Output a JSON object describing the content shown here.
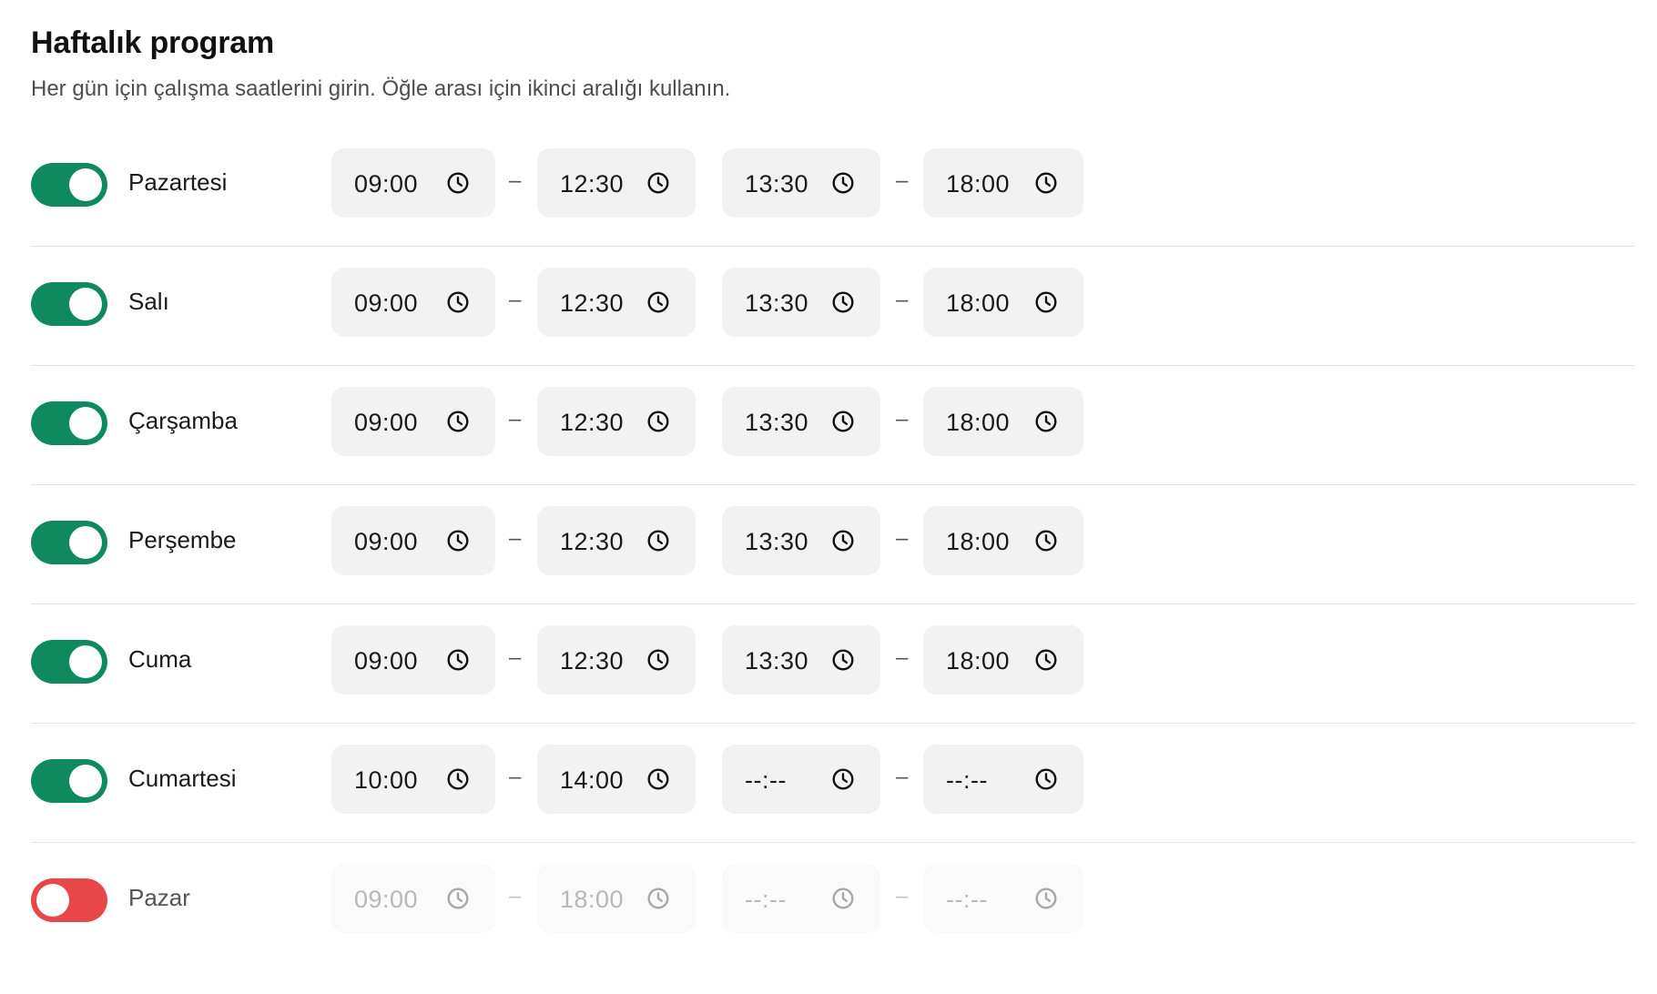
{
  "header": {
    "title": "Haftalık program",
    "subtitle": "Her gün için çalışma saatlerini girin. Öğle arası için ikinci aralığı kullanın."
  },
  "separator": "–",
  "icons": {
    "toggle": "toggle-switch",
    "time": "clock-icon"
  },
  "colors": {
    "toggle_on": "#0f8a5f",
    "toggle_off": "#e8474a",
    "field_bg": "#f2f2f2"
  },
  "days": [
    {
      "label": "Pazartesi",
      "enabled": true,
      "start1": "09:00",
      "end1": "12:30",
      "start2": "13:30",
      "end2": "18:00"
    },
    {
      "label": "Salı",
      "enabled": true,
      "start1": "09:00",
      "end1": "12:30",
      "start2": "13:30",
      "end2": "18:00"
    },
    {
      "label": "Çarşamba",
      "enabled": true,
      "start1": "09:00",
      "end1": "12:30",
      "start2": "13:30",
      "end2": "18:00"
    },
    {
      "label": "Perşembe",
      "enabled": true,
      "start1": "09:00",
      "end1": "12:30",
      "start2": "13:30",
      "end2": "18:00"
    },
    {
      "label": "Cuma",
      "enabled": true,
      "start1": "09:00",
      "end1": "12:30",
      "start2": "13:30",
      "end2": "18:00"
    },
    {
      "label": "Cumartesi",
      "enabled": true,
      "start1": "10:00",
      "end1": "14:00",
      "start2": "--:--",
      "end2": "--:--"
    },
    {
      "label": "Pazar",
      "enabled": false,
      "start1": "09:00",
      "end1": "18:00",
      "start2": "--:--",
      "end2": "--:--"
    }
  ]
}
